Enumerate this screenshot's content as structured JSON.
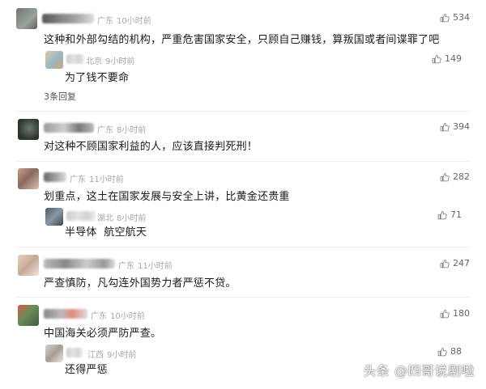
{
  "comments": [
    {
      "location": "广东",
      "time": "10小时前",
      "text": "这种和外部勾结的机构，严重危害国家安全，只顾自己赚钱，算叛国或者间谍罪了吧",
      "likes": "534",
      "replies": [
        {
          "location": "北京",
          "time": "9小时前",
          "text": "为了钱不要命",
          "likes": "149"
        }
      ],
      "more_replies": "3条回复"
    },
    {
      "location": "广东",
      "time": "8小时前",
      "text": "对这种不顾国家利益的人，应该直接判死刑！",
      "likes": "394"
    },
    {
      "location": "广东",
      "time": "11小时前",
      "text": "划重点，这土在国家发展与安全上讲，比黄金还贵重",
      "likes": "282",
      "replies": [
        {
          "location": "湖北",
          "time": "8小时前",
          "text": "半导体  航空航天",
          "likes": "71"
        }
      ]
    },
    {
      "location": "广东",
      "time": "11小时前",
      "text": "严查慎防，凡勾连外国势力者严惩不贷。",
      "likes": "247"
    },
    {
      "location": "广东",
      "time": "10小时前",
      "text": "中国海关必须严防严查。",
      "likes": "180",
      "replies": [
        {
          "location": "江西",
          "time": "9小时前",
          "text": "还得严惩",
          "likes": "88"
        }
      ]
    }
  ],
  "icons": {
    "like": "thumbs-up-icon"
  },
  "watermark": "头条 @四哥说剧啦",
  "colors": {
    "meta": "#a6a6a6",
    "text": "#1a1a1a",
    "likes": "#666666"
  }
}
